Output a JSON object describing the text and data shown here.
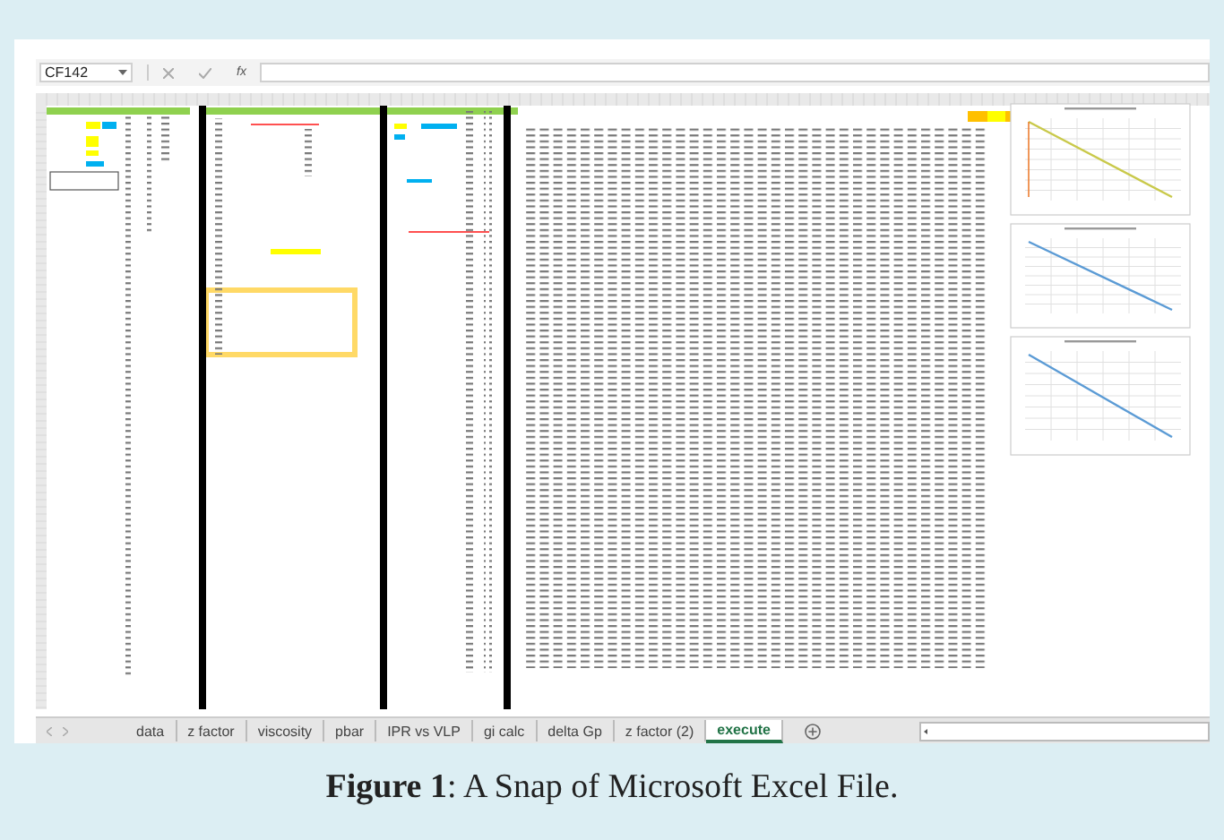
{
  "spreadsheet": {
    "name_box": "CF142",
    "function_label": "fx",
    "sheet_tabs": [
      {
        "label": "data",
        "selected": false
      },
      {
        "label": "z factor",
        "selected": false
      },
      {
        "label": "viscosity",
        "selected": false
      },
      {
        "label": "pbar",
        "selected": false
      },
      {
        "label": "IPR vs VLP",
        "selected": false
      },
      {
        "label": "gi calc",
        "selected": false
      },
      {
        "label": "delta Gp",
        "selected": false
      },
      {
        "label": "z factor (2)",
        "selected": false
      },
      {
        "label": "execute",
        "selected": true
      }
    ]
  },
  "caption": "**Figure 1**: A Snap of Microsoft Excel File."
}
